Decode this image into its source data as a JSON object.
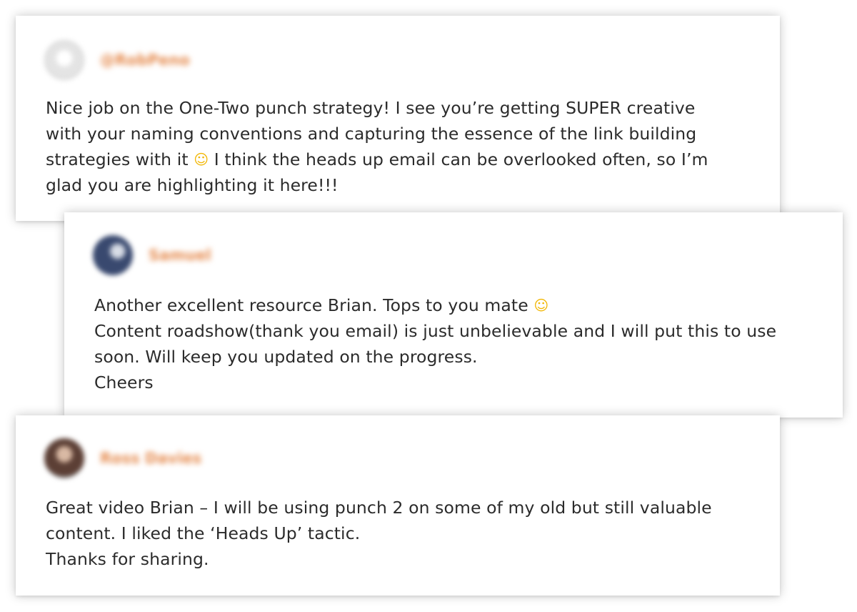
{
  "comments": [
    {
      "author": "@RobPeno",
      "lines": [
        "Nice job on the One-Two punch strategy! I see you’re getting SUPER creative",
        "with your naming conventions and capturing the essence of the link building",
        [
          "strategies with it ",
          " I think the heads up email can be overlooked often, so I’m"
        ],
        "glad you are highlighting it here!!!"
      ]
    },
    {
      "author": "Samuel",
      "lines": [
        [
          "Another excellent resource Brian. Tops to you mate ",
          ""
        ],
        "Content roadshow(thank you email) is just unbelievable and I will put this to use",
        "soon. Will keep you updated on the progress.",
        "Cheers"
      ]
    },
    {
      "author": "Ross Davies",
      "lines": [
        "Great video Brian – I will be using punch 2 on some of my old but still valuable",
        "content. I liked the ‘Heads Up’ tactic.",
        "Thanks for sharing."
      ]
    }
  ],
  "emoji": {
    "glyph": "☺",
    "name": "smiley-emoji-icon"
  },
  "colors": {
    "author_name": "#e58a4d",
    "text": "#2b2b2b"
  }
}
